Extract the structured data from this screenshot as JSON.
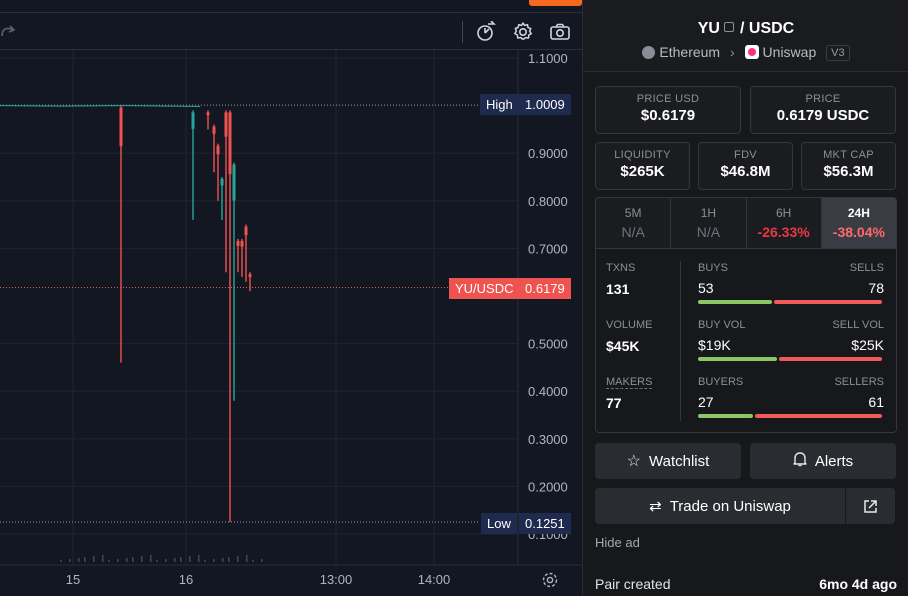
{
  "chart": {
    "price_axis": [
      "1.1000",
      "1.0009",
      "0.9000",
      "0.8000",
      "0.7000",
      "0.6179",
      "0.5000",
      "0.4000",
      "0.3000",
      "0.2000",
      "0.1251",
      "0.1000"
    ],
    "time_axis": [
      "15",
      "16",
      "13:00",
      "14:00"
    ],
    "high_tag": "High",
    "high_value": "1.0009",
    "low_tag": "Low",
    "low_value": "0.1251",
    "pair_tag": "YU/USDC",
    "pair_value": "0.6179",
    "colors": {
      "up": "#26a69a",
      "down": "#ef5350",
      "accent": "#f7671f"
    }
  },
  "chart_data": {
    "type": "line",
    "title": "",
    "xlabel": "",
    "ylabel": "",
    "ylim": [
      0.05,
      1.12
    ],
    "x_ticks": [
      "15",
      "16",
      "13:00",
      "14:00"
    ],
    "y_ticks": [
      0.1,
      0.2,
      0.3,
      0.4,
      0.5,
      0.7,
      0.8,
      0.9,
      1.1
    ],
    "high": 1.0009,
    "low": 0.1251,
    "last": 0.6179,
    "wicks": [
      {
        "x": 121,
        "low": 0.46,
        "high": 1.0,
        "color": "down"
      },
      {
        "x": 193,
        "low": 0.76,
        "high": 0.99,
        "color": "up"
      },
      {
        "x": 208,
        "low": 0.95,
        "high": 0.99,
        "color": "down"
      },
      {
        "x": 214,
        "low": 0.86,
        "high": 0.96,
        "color": "down"
      },
      {
        "x": 218,
        "low": 0.8,
        "high": 0.92,
        "color": "down"
      },
      {
        "x": 222,
        "low": 0.76,
        "high": 0.85,
        "color": "up"
      },
      {
        "x": 226,
        "low": 0.65,
        "high": 0.99,
        "color": "down"
      },
      {
        "x": 230,
        "low": 0.125,
        "high": 0.99,
        "color": "down"
      },
      {
        "x": 234,
        "low": 0.38,
        "high": 0.88,
        "color": "up"
      },
      {
        "x": 238,
        "low": 0.65,
        "high": 0.72,
        "color": "down"
      },
      {
        "x": 242,
        "low": 0.64,
        "high": 0.72,
        "color": "down"
      },
      {
        "x": 246,
        "low": 0.63,
        "high": 0.75,
        "color": "down"
      },
      {
        "x": 250,
        "low": 0.61,
        "high": 0.65,
        "color": "down"
      }
    ]
  },
  "panel": {
    "base": "YU",
    "quote": "USDC",
    "separator": "/",
    "chain": "Ethereum",
    "dex": "Uniswap",
    "version": "V3",
    "price_usd_label": "PRICE USD",
    "price_usd": "$0.6179",
    "price_label": "PRICE",
    "price": "0.6179 USDC",
    "liquidity_label": "LIQUIDITY",
    "liquidity": "$265K",
    "fdv_label": "FDV",
    "fdv": "$46.8M",
    "mktcap_label": "MKT CAP",
    "mktcap": "$56.3M",
    "timeframes": [
      {
        "label": "5M",
        "value": "N/A"
      },
      {
        "label": "1H",
        "value": "N/A"
      },
      {
        "label": "6H",
        "value": "-26.33%"
      },
      {
        "label": "24H",
        "value": "-38.04%"
      }
    ],
    "txns_label": "TXNS",
    "txns": "131",
    "volume_label": "VOLUME",
    "volume": "$45K",
    "makers_label": "MAKERS",
    "makers": "77",
    "buys_label": "BUYS",
    "buys": "53",
    "sells_label": "SELLS",
    "sells": "78",
    "buyvol_label": "BUY VOL",
    "buyvol": "$19K",
    "sellvol_label": "SELL VOL",
    "sellvol": "$25K",
    "buyers_label": "BUYERS",
    "buyers": "27",
    "sellers_label": "SELLERS",
    "sellers": "61",
    "watchlist": "Watchlist",
    "alerts": "Alerts",
    "trade": "Trade on Uniswap",
    "hide_ad": "Hide ad",
    "pair_created_label": "Pair created",
    "pair_created_value": "6mo 4d ago"
  }
}
